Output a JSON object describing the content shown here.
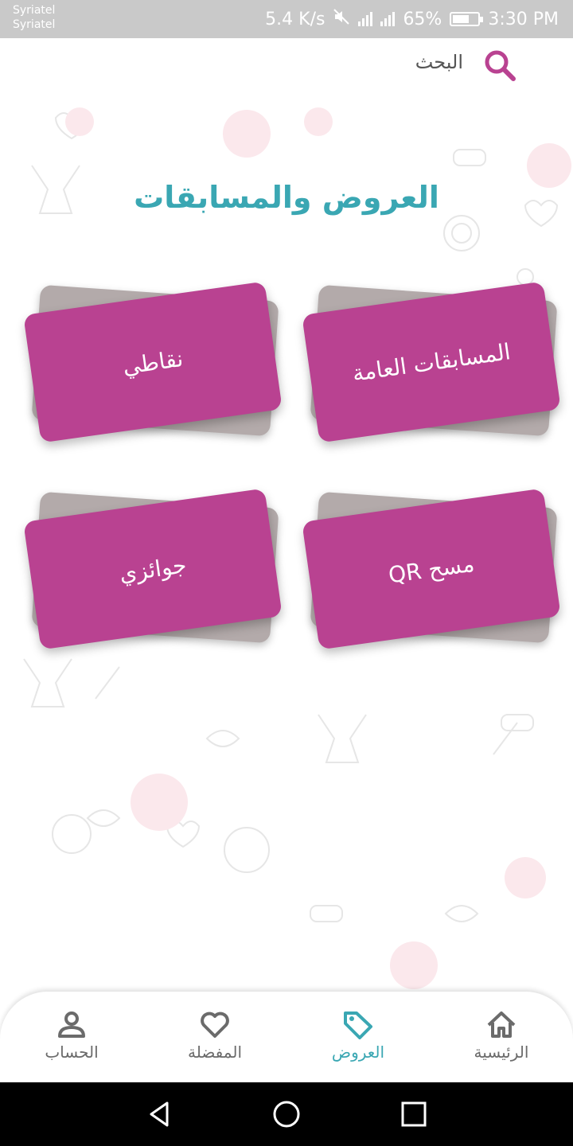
{
  "status_bar": {
    "carrier_1": "Syriatel",
    "carrier_2": "Syriatel",
    "speed": "5.4 K/s",
    "battery_text": "65%",
    "battery_level": 0.65,
    "time": "3:30 PM"
  },
  "header": {
    "search_label": "البحث"
  },
  "page_title": "العروض والمسابقات",
  "cards": [
    {
      "label": "المسابقات العامة"
    },
    {
      "label": "نقاطي"
    },
    {
      "label": "مسح QR"
    },
    {
      "label": "جوائزي"
    }
  ],
  "bottom_nav": {
    "items": [
      {
        "label": "الرئيسية",
        "icon": "home-icon"
      },
      {
        "label": "العروض",
        "icon": "tag-icon",
        "active": true
      },
      {
        "label": "المفضلة",
        "icon": "heart-icon"
      },
      {
        "label": "الحساب",
        "icon": "user-icon"
      }
    ]
  },
  "colors": {
    "accent": "#3aa7b3",
    "card": "#b94291",
    "card_back": "#b3aaaa"
  }
}
